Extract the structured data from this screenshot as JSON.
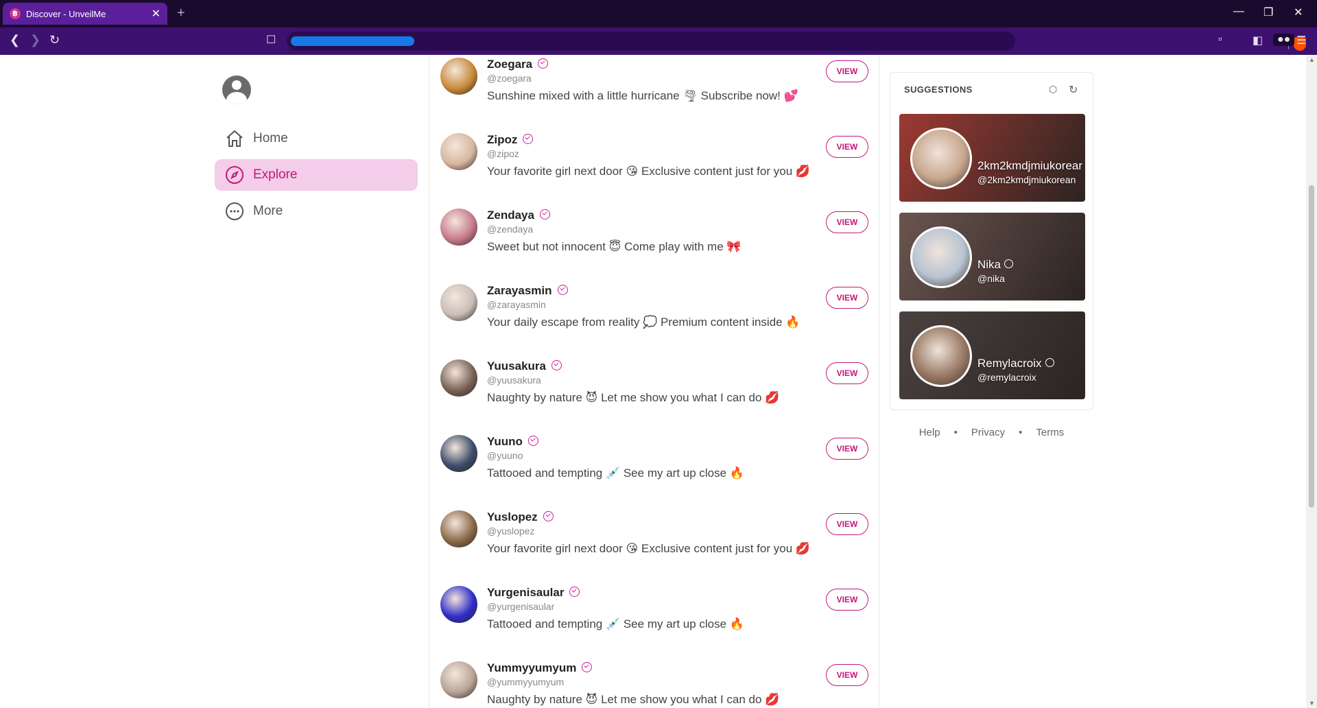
{
  "browser": {
    "tab_title": "Discover - UnveilMe",
    "favicon_glyph": "฿",
    "close_glyph": "✕",
    "newtab_glyph": "+",
    "minimize_glyph": "—",
    "restore_glyph": "❐",
    "close_window_glyph": "✕",
    "back_glyph": "❮",
    "forward_glyph": "❯",
    "reload_glyph": "↻",
    "bookmark_glyph": "☐",
    "menu_glyph": "☰",
    "url_hidden": true
  },
  "nav": {
    "items": [
      {
        "label": "Home",
        "icon": "home-icon",
        "active": false
      },
      {
        "label": "Explore",
        "icon": "compass-icon",
        "active": true
      },
      {
        "label": "More",
        "icon": "more-icon",
        "active": false
      }
    ]
  },
  "feed": {
    "view_label": "VIEW",
    "rows": [
      {
        "name": "Zoegara",
        "handle": "@zoegara",
        "bio": "Sunshine mixed with a little hurricane 🌪 Subscribe now! 💕",
        "color": "#c98a3a"
      },
      {
        "name": "Zipoz",
        "handle": "@zipoz",
        "bio": "Your favorite girl next door 😘 Exclusive content just for you 💋",
        "color": "#d7b7a0"
      },
      {
        "name": "Zendaya",
        "handle": "@zendaya",
        "bio": "Sweet but not innocent 😇 Come play with me 🎀",
        "color": "#c77a8c"
      },
      {
        "name": "Zarayasmin",
        "handle": "@zarayasmin",
        "bio": "Your daily escape from reality 💭 Premium content inside 🔥",
        "color": "#c9bdb6"
      },
      {
        "name": "Yuusakura",
        "handle": "@yuusakura",
        "bio": "Naughty by nature 😈 Let me show you what I can do 💋",
        "color": "#7a6258"
      },
      {
        "name": "Yuuno",
        "handle": "@yuuno",
        "bio": "Tattooed and tempting 💉 See my art up close 🔥",
        "color": "#3d4d6a"
      },
      {
        "name": "Yuslopez",
        "handle": "@yuslopez",
        "bio": "Your favorite girl next door 😘 Exclusive content just for you 💋",
        "color": "#8a6a48"
      },
      {
        "name": "Yurgenisaular",
        "handle": "@yurgenisaular",
        "bio": "Tattooed and tempting 💉 See my art up close 🔥",
        "color": "#2e2ec9"
      },
      {
        "name": "Yummyyumyum",
        "handle": "@yummyyumyum",
        "bio": "Naughty by nature 😈 Let me show you what I can do 💋",
        "color": "#b8a596"
      }
    ]
  },
  "suggestions": {
    "title": "SUGGESTIONS",
    "tag_glyph": "⬡",
    "refresh_glyph": "↻",
    "cards": [
      {
        "name": "2km2kmdjmiukorear",
        "handle": "@2km2kmdjmiukorean",
        "verified": false,
        "bg": "#9c3a32",
        "avatar": "#c9a78f"
      },
      {
        "name": "Nika",
        "handle": "@nika",
        "verified": true,
        "bg": "#6b5550",
        "avatar": "#b9c4d2"
      },
      {
        "name": "Remylacroix",
        "handle": "@remylacroix",
        "verified": true,
        "bg": "#4a4240",
        "avatar": "#9a7a66"
      }
    ]
  },
  "footer": {
    "links": [
      "Help",
      "Privacy",
      "Terms"
    ],
    "sep": "•"
  }
}
